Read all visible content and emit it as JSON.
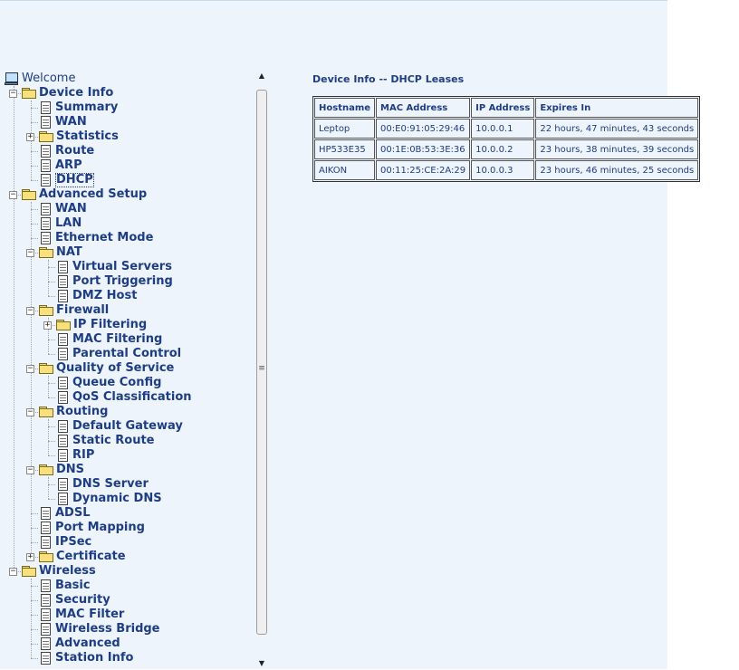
{
  "tree": [
    {
      "label": "Welcome",
      "level": 0,
      "icon": "computer",
      "expander": null,
      "root": true
    },
    {
      "label": "Device Info",
      "level": 1,
      "icon": "folder",
      "expander": "minus"
    },
    {
      "label": "Summary",
      "level": 2,
      "icon": "page"
    },
    {
      "label": "WAN",
      "level": 2,
      "icon": "page"
    },
    {
      "label": "Statistics",
      "level": 2,
      "icon": "folder",
      "expander": "plus"
    },
    {
      "label": "Route",
      "level": 2,
      "icon": "page"
    },
    {
      "label": "ARP",
      "level": 2,
      "icon": "page"
    },
    {
      "label": "DHCP",
      "level": 2,
      "icon": "page",
      "selected": true
    },
    {
      "label": "Advanced Setup",
      "level": 1,
      "icon": "folder",
      "expander": "minus"
    },
    {
      "label": "WAN",
      "level": 2,
      "icon": "page"
    },
    {
      "label": "LAN",
      "level": 2,
      "icon": "page"
    },
    {
      "label": "Ethernet Mode",
      "level": 2,
      "icon": "page"
    },
    {
      "label": "NAT",
      "level": 2,
      "icon": "folder",
      "expander": "minus"
    },
    {
      "label": "Virtual Servers",
      "level": 3,
      "icon": "page"
    },
    {
      "label": "Port Triggering",
      "level": 3,
      "icon": "page"
    },
    {
      "label": "DMZ Host",
      "level": 3,
      "icon": "page"
    },
    {
      "label": "Firewall",
      "level": 2,
      "icon": "folder",
      "expander": "minus"
    },
    {
      "label": "IP Filtering",
      "level": 3,
      "icon": "folder",
      "expander": "plus"
    },
    {
      "label": "MAC Filtering",
      "level": 3,
      "icon": "page"
    },
    {
      "label": "Parental Control",
      "level": 3,
      "icon": "page"
    },
    {
      "label": "Quality of Service",
      "level": 2,
      "icon": "folder",
      "expander": "minus"
    },
    {
      "label": "Queue Config",
      "level": 3,
      "icon": "page"
    },
    {
      "label": "QoS Classification",
      "level": 3,
      "icon": "page"
    },
    {
      "label": "Routing",
      "level": 2,
      "icon": "folder",
      "expander": "minus"
    },
    {
      "label": "Default Gateway",
      "level": 3,
      "icon": "page"
    },
    {
      "label": "Static Route",
      "level": 3,
      "icon": "page"
    },
    {
      "label": "RIP",
      "level": 3,
      "icon": "page"
    },
    {
      "label": "DNS",
      "level": 2,
      "icon": "folder",
      "expander": "minus"
    },
    {
      "label": "DNS Server",
      "level": 3,
      "icon": "page"
    },
    {
      "label": "Dynamic DNS",
      "level": 3,
      "icon": "page"
    },
    {
      "label": "ADSL",
      "level": 2,
      "icon": "page"
    },
    {
      "label": "Port Mapping",
      "level": 2,
      "icon": "page"
    },
    {
      "label": "IPSec",
      "level": 2,
      "icon": "page"
    },
    {
      "label": "Certificate",
      "level": 2,
      "icon": "folder",
      "expander": "plus"
    },
    {
      "label": "Wireless",
      "level": 1,
      "icon": "folder",
      "expander": "minus"
    },
    {
      "label": "Basic",
      "level": 2,
      "icon": "page"
    },
    {
      "label": "Security",
      "level": 2,
      "icon": "page"
    },
    {
      "label": "MAC Filter",
      "level": 2,
      "icon": "page"
    },
    {
      "label": "Wireless Bridge",
      "level": 2,
      "icon": "page"
    },
    {
      "label": "Advanced",
      "level": 2,
      "icon": "page"
    },
    {
      "label": "Station Info",
      "level": 2,
      "icon": "page"
    }
  ],
  "main": {
    "title": "Device Info -- DHCP Leases",
    "columns": [
      "Hostname",
      "MAC Address",
      "IP Address",
      "Expires In"
    ],
    "rows": [
      [
        "Leptop",
        "00:E0:91:05:29:46",
        "10.0.0.1",
        "22 hours, 47 minutes, 43 seconds"
      ],
      [
        "HP533E35",
        "00:1E:0B:53:3E:36",
        "10.0.0.2",
        "23 hours, 38 minutes, 39 seconds"
      ],
      [
        "AIKON",
        "00:11:25:CE:2A:29",
        "10.0.0.3",
        "23 hours, 46 minutes, 25 seconds"
      ]
    ]
  },
  "scrollbar": {
    "up_glyph": "▲",
    "down_glyph": "▼",
    "grip_glyph": "≡"
  }
}
